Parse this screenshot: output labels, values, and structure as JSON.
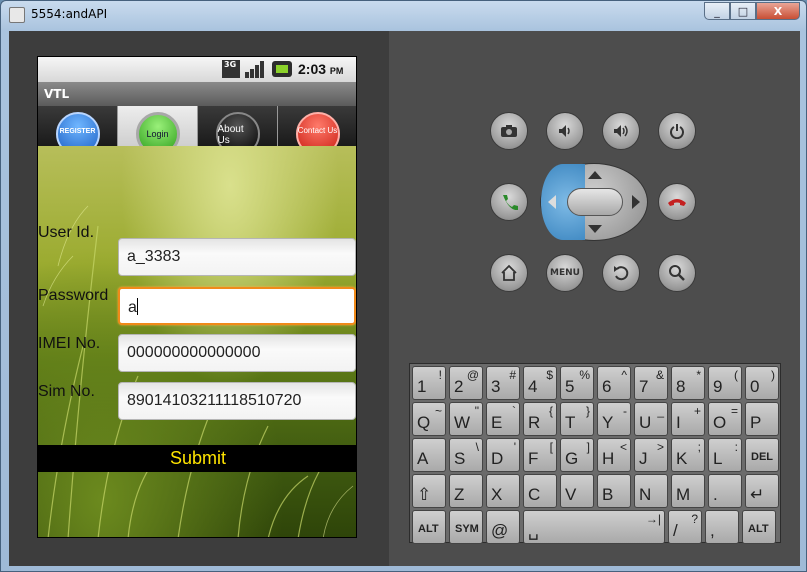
{
  "window": {
    "title": "5554:andAPI",
    "controls": [
      "_",
      "□",
      "X"
    ]
  },
  "status_bar": {
    "network": "3G",
    "time": "2:03",
    "ampm": "PM"
  },
  "app": {
    "title": "VTL",
    "tabs": [
      {
        "label": "REGISTER",
        "color": "blue"
      },
      {
        "label": "Login",
        "color": "green"
      },
      {
        "label": "About Us",
        "color": "black"
      },
      {
        "label": "Contact Us",
        "color": "red"
      }
    ],
    "form": {
      "user_id_label": "User Id.",
      "user_id_value": "a_3383",
      "password_label": "Password",
      "password_value": "a",
      "imei_label": "IMEI No.",
      "imei_value": "000000000000000",
      "sim_label": "Sim No.",
      "sim_value": "89014103211118510720",
      "submit_label": "Submit"
    }
  },
  "controls": {
    "buttons": [
      "camera-icon",
      "volume-down-icon",
      "volume-up-icon",
      "power-icon",
      "call-icon",
      "end-call-icon",
      "home-icon",
      "back-icon",
      "search-icon"
    ],
    "menu_label": "MENU"
  },
  "keyboard": {
    "rows": [
      [
        [
          "1",
          "!"
        ],
        [
          "2",
          "@"
        ],
        [
          "3",
          "#"
        ],
        [
          "4",
          "$"
        ],
        [
          "5",
          "%"
        ],
        [
          "6",
          "^"
        ],
        [
          "7",
          "&"
        ],
        [
          "8",
          "*"
        ],
        [
          "9",
          "("
        ],
        [
          "0",
          ")"
        ]
      ],
      [
        [
          "Q",
          "~"
        ],
        [
          "W",
          "\""
        ],
        [
          "E",
          "`"
        ],
        [
          "R",
          "{"
        ],
        [
          "T",
          "}"
        ],
        [
          "Y",
          "-"
        ],
        [
          "U",
          "_"
        ],
        [
          "I",
          "+"
        ],
        [
          "O",
          "="
        ],
        [
          "P",
          ""
        ]
      ],
      [
        [
          "A",
          ""
        ],
        [
          "S",
          "\\"
        ],
        [
          "D",
          "'"
        ],
        [
          "F",
          "["
        ],
        [
          "G",
          "]"
        ],
        [
          "H",
          "<"
        ],
        [
          "J",
          ">"
        ],
        [
          "K",
          ";"
        ],
        [
          "L",
          ":"
        ],
        [
          "DEL",
          ""
        ]
      ],
      [
        [
          "⇧",
          ""
        ],
        [
          "Z",
          ""
        ],
        [
          "X",
          ""
        ],
        [
          "C",
          ""
        ],
        [
          "V",
          ""
        ],
        [
          "B",
          ""
        ],
        [
          "N",
          ""
        ],
        [
          "M",
          ""
        ],
        [
          ".",
          ""
        ],
        [
          "↵",
          ""
        ]
      ],
      [
        [
          "ALT",
          ""
        ],
        [
          "SYM",
          ""
        ],
        [
          "@",
          ""
        ],
        [
          "␣",
          "→|"
        ],
        [
          "/",
          "?"
        ],
        [
          ",",
          ""
        ],
        [
          "ALT",
          ""
        ]
      ]
    ]
  }
}
